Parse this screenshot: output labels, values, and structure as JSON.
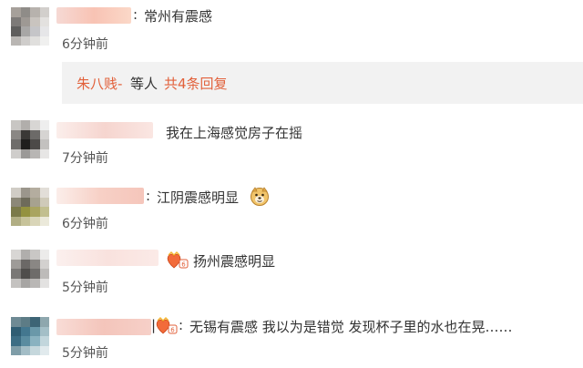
{
  "comments": [
    {
      "text": "常州有震感",
      "time": "6分钟前"
    },
    {
      "text": "我在上海感觉房子在摇",
      "time": "7分钟前"
    },
    {
      "text": "江阴震感明显",
      "time": "6分钟前",
      "emoji": "doge-emoji"
    },
    {
      "text": "扬州震感明显",
      "time": "5分钟前",
      "badge": "vip-heart-badge"
    },
    {
      "text": "无锡有震感 我以为是错觉 发现杯子里的水也在晃……",
      "time": "5分钟前",
      "badge": "vip-heart-badge"
    }
  ],
  "reply": {
    "user": "朱八贱-",
    "middle": "等人",
    "count": "共4条回复"
  },
  "colors": {
    "accent": "#e2613b",
    "reply_bg": "#f2f2f2",
    "text": "#333333",
    "time": "#555555"
  }
}
